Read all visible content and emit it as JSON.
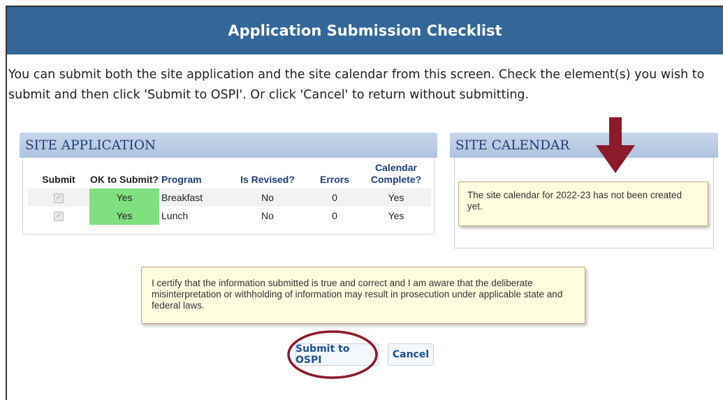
{
  "title": "Application Submission Checklist",
  "intro": "You can submit both the site application and the site calendar from this screen. Check the element(s) you wish to submit and then click 'Submit to OSPI'. Or click 'Cancel' to return without submitting.",
  "site_application": {
    "header": "SITE APPLICATION",
    "columns": {
      "submit": "Submit",
      "ok": "OK to Submit?",
      "program": "Program",
      "revised": "Is Revised?",
      "errors": "Errors",
      "calendar": "Calendar Complete?"
    },
    "rows": [
      {
        "submit_checked": true,
        "ok": "Yes",
        "program": "Breakfast",
        "revised": "No",
        "errors": "0",
        "calendar": "Yes"
      },
      {
        "submit_checked": true,
        "ok": "Yes",
        "program": "Lunch",
        "revised": "No",
        "errors": "0",
        "calendar": "Yes"
      }
    ]
  },
  "site_calendar": {
    "header": "SITE CALENDAR",
    "message": "The site calendar for 2022-23 has not been created yet."
  },
  "certification": "I certify that the information submitted is true and correct and I am aware that the deliberate misinterpretation or withholding of information may result in prosecution under applicable state and federal laws.",
  "buttons": {
    "submit": "Submit to OSPI",
    "cancel": "Cancel"
  },
  "colors": {
    "title_bar": "#336699",
    "ok_cell": "#80e080",
    "annotation": "#8b1a2b"
  },
  "icons": {
    "arrow": "down-arrow-icon",
    "highlight": "highlight-circle"
  }
}
